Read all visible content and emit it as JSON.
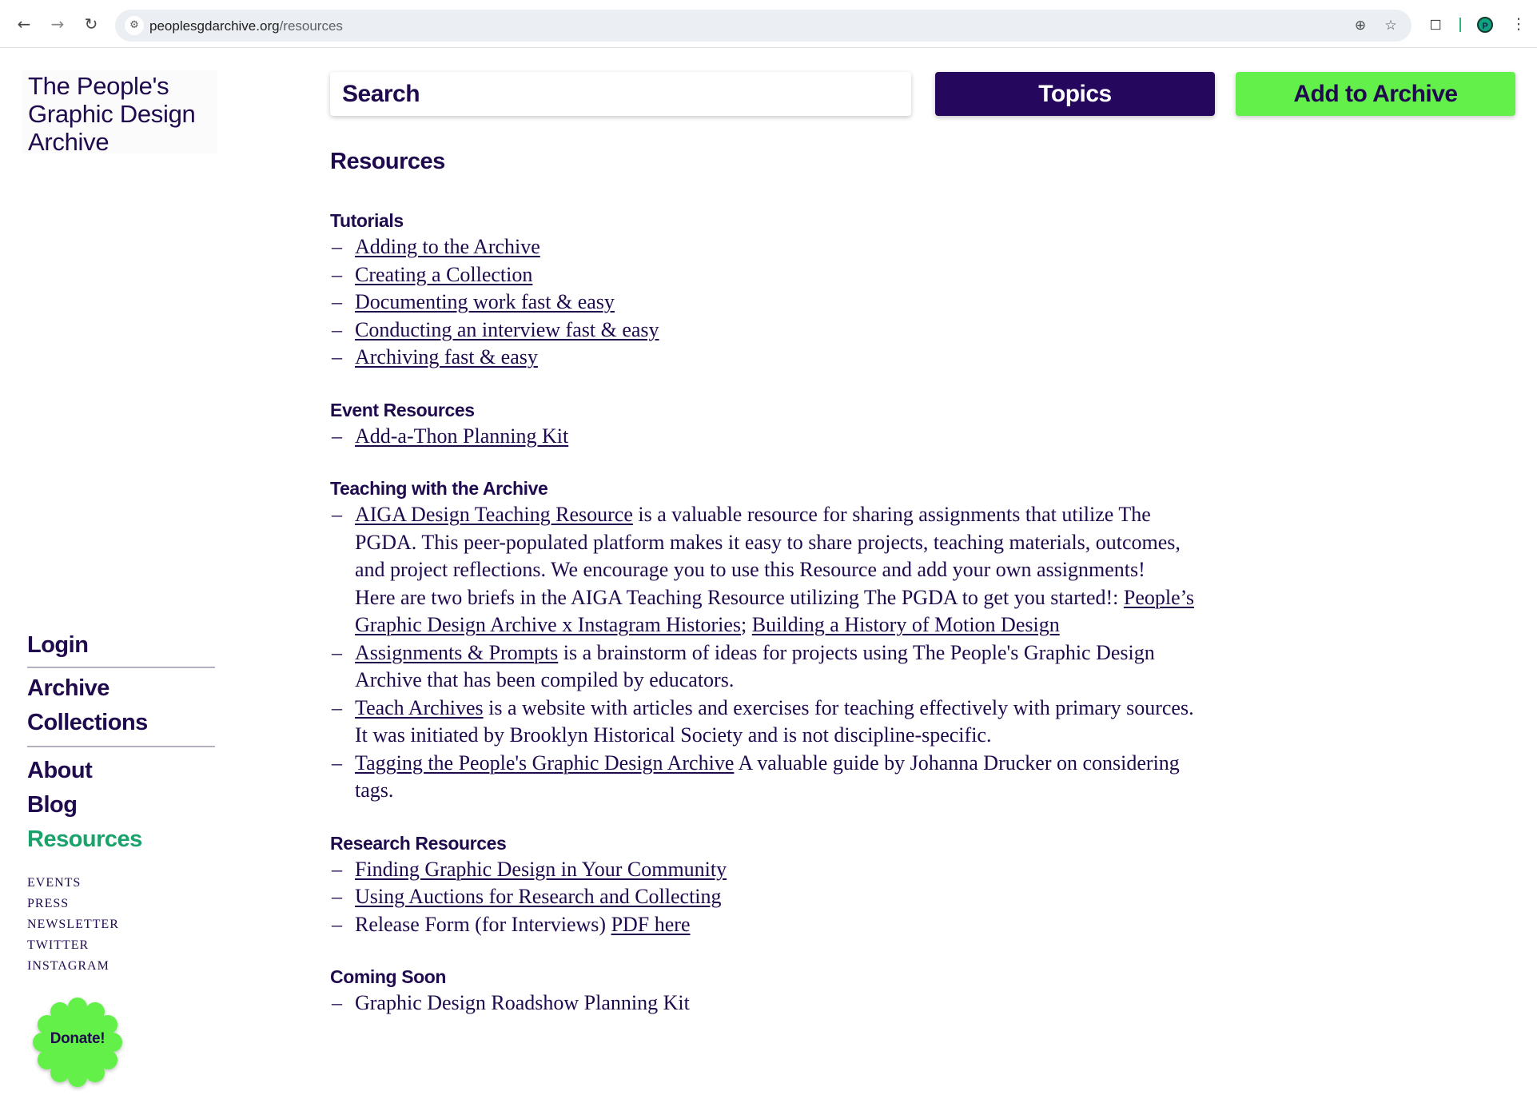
{
  "browser": {
    "url_host": "peoplesgdarchive.org",
    "url_path": "/resources",
    "profile_initial": "P"
  },
  "logo": {
    "line1": "The People's",
    "line2": "Graphic Design",
    "line3": "Archive"
  },
  "nav": {
    "login": "Login",
    "archive": "Archive",
    "collections": "Collections",
    "about": "About",
    "blog": "Blog",
    "resources": "Resources",
    "events": "EVENTS",
    "press": "PRESS",
    "newsletter": "NEWSLETTER",
    "twitter": "TWITTER",
    "instagram": "INSTAGRAM",
    "donate": "Donate!"
  },
  "header": {
    "search": "Search",
    "topics": "Topics",
    "add": "Add to Archive"
  },
  "colors": {
    "brand_purple": "#25075e",
    "text": "#1f0a4d",
    "accent_green": "#63f04a",
    "active_nav": "#1aa26b"
  },
  "page": {
    "title": "Resources",
    "tutorials": {
      "title": "Tutorials",
      "items": [
        "Adding to the Archive",
        "Creating a Collection",
        "Documenting work fast & easy",
        "Conducting an interview fast & easy",
        "Archiving fast & easy"
      ]
    },
    "events": {
      "title": "Event Resources",
      "items": [
        "Add-a-Thon Planning Kit"
      ]
    },
    "teaching": {
      "title": "Teaching with the Archive",
      "aiga_link": "AIGA Design Teaching Resource",
      "aiga_text": " is a valuable resource for sharing assignments that utilize The PGDA. This peer-populated platform makes it easy to share projects, teaching materials, outcomes, and project reflections. We encourage you to use this Resource and add your own assignments!",
      "briefs_text": "Here are two briefs in the AIGA Teaching Resource utilizing The PGDA to get you started!: ",
      "brief1_link": "People’s Graphic Design Archive x Instagram Histories",
      "brief_sep": "; ",
      "brief2_link": "Building a History of Motion Design",
      "assign_link": "Assignments & Prompts",
      "assign_text": " is a brainstorm of ideas for projects using The People's Graphic Design Archive that has been compiled by educators.",
      "teach_link": "Teach Archives",
      "teach_text": " is a website with articles and exercises for teaching effectively with primary sources. It was initiated by Brooklyn Historical Society and is not discipline-specific.",
      "tag_link": "Tagging the People's Graphic Design Archive",
      "tag_text": " A valuable guide by Johanna Drucker on considering tags."
    },
    "research": {
      "title": "Research Resources",
      "link1": "Finding Graphic Design in Your Community",
      "link2": "Using Auctions for Research and Collecting",
      "release_text": "Release Form (for Interviews) ",
      "release_link": "PDF here"
    },
    "soon": {
      "title": "Coming Soon",
      "items": [
        "Graphic Design Roadshow Planning Kit"
      ]
    }
  }
}
